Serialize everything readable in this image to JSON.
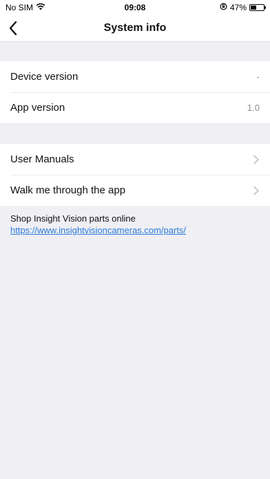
{
  "status_bar": {
    "carrier": "No SIM",
    "time": "09:08",
    "battery": "47%",
    "battery_level": 0.47,
    "icons": [
      "wifi-icon",
      "rotation-lock-icon",
      "battery-icon"
    ]
  },
  "nav": {
    "title": "System info",
    "back_icon": "chevron-left-icon"
  },
  "info": [
    {
      "label": "Device version",
      "value": "-"
    },
    {
      "label": "App version",
      "value": "1.0"
    }
  ],
  "links": [
    {
      "label": "User Manuals",
      "icon": "chevron-right-icon"
    },
    {
      "label": "Walk me through the app",
      "icon": "chevron-right-icon"
    }
  ],
  "footer": {
    "text": "Shop Insight Vision parts online ",
    "url_text": "https://www.insightvisioncameras.com/parts/"
  },
  "colors": {
    "background": "#efeff4",
    "link": "#2b7bd6",
    "secondary": "#8e8e93"
  }
}
